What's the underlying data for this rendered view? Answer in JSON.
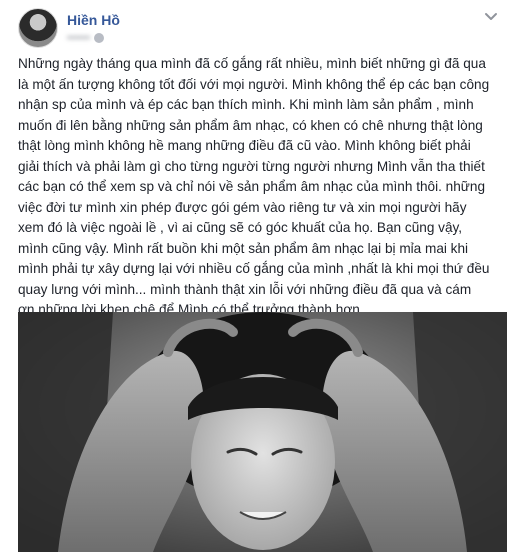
{
  "post": {
    "author_name": "Hiền Hồ",
    "time": "••••••",
    "lines": [
      "Những ngày tháng qua mình đã cố gắng rất nhiều, mình biết những gì đã qua",
      "là một ấn tượng không tốt đối với mọi người. Mình không thể ép các bạn công",
      "nhận sp của mình và ép các bạn thích mình. Khi mình làm sản phẩm , mình",
      "muốn đi lên bằng những sản phẩm âm nhạc, có khen có chê nhưng thật lòng",
      "thật lòng mình không hề mang những điều đã cũ vào. Mình không biết phải",
      "giải thích và phải làm gì cho từng người từng người nhưng Mình vẫn tha thiết",
      "các bạn có thể xem sp và chỉ nói về sản phẩm âm nhạc của mình thôi. những",
      "việc đời tư mình xin phép được gói gém vào riêng tư và xin mọi người hãy",
      "xem đó là việc ngoài lề , vì ai cũng sẽ có góc khuất của họ. Bạn cũng vậy,",
      "mình cũng vậy. Mình rất buồn khi một sản phẩm âm nhạc lại bị mỉa mai khi",
      "mình phải tự xây dựng lại với nhiều cố gắng của mình ,nhất là khi mọi thứ đều",
      "quay lưng với mình... mình thành thật xin lỗi với những điều đã qua và cám",
      "ơn những lời khen chê để Mình có thể trưởng thành hơn..."
    ]
  },
  "icons": {
    "options": "chevron-down-icon",
    "privacy": "globe-icon",
    "avatar": "profile-photo"
  },
  "colors": {
    "author": "#365899",
    "text": "#1d2129",
    "meta": "#90949c"
  }
}
